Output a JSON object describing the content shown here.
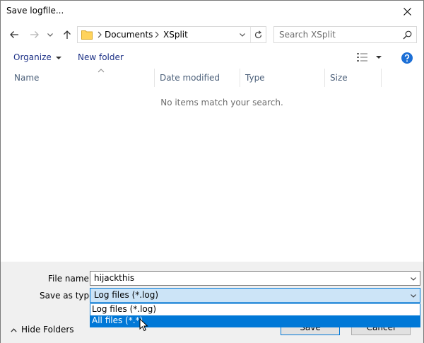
{
  "window": {
    "title": "Save logfile..."
  },
  "navigation": {
    "breadcrumbs": [
      "Documents",
      "XSplit"
    ],
    "search_placeholder": "Search XSplit"
  },
  "toolbar": {
    "organize_label": "Organize",
    "new_folder_label": "New folder"
  },
  "file_list": {
    "columns": [
      "Name",
      "Date modified",
      "Type",
      "Size"
    ],
    "empty_message": "No items match your search."
  },
  "form": {
    "file_name_label": "File name:",
    "file_name_value": "hijackthis",
    "save_type_label": "Save as type:",
    "save_type_value": "Log files (*.log)",
    "save_type_options": [
      "Log files (*.log)",
      "All files (*.*)"
    ],
    "save_type_highlighted": "All files (*.*)"
  },
  "footer": {
    "hide_folders_label": "Hide Folders",
    "save_label": "Save",
    "cancel_label": "Cancel"
  },
  "colors": {
    "accent": "#0078d7",
    "link": "#1e3287",
    "help": "#1c6fd6",
    "folder": "#ffd35b"
  }
}
